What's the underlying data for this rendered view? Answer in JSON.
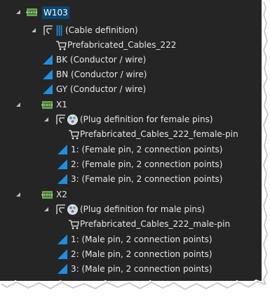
{
  "tree": {
    "rows": [
      {
        "label": "W103",
        "icon": "cable-icon",
        "expander": "open",
        "selected": true
      },
      {
        "label": "(Cable definition)",
        "icon": "cable-definition-icon",
        "expander": "open"
      },
      {
        "label": "Prefabricated_Cables_222",
        "icon": "shopping-cart-icon",
        "expander": "none"
      },
      {
        "label": "BK (Conductor / wire)",
        "icon": "wire-triangle-icon",
        "expander": "none"
      },
      {
        "label": "BN (Conductor / wire)",
        "icon": "wire-triangle-icon",
        "expander": "none"
      },
      {
        "label": "GY (Conductor / wire)",
        "icon": "wire-triangle-icon",
        "expander": "none"
      },
      {
        "label": "X1",
        "icon": "connector-icon",
        "expander": "open"
      },
      {
        "label": "(Plug definition for female pins)",
        "icon": "plug-definition-icon",
        "expander": "open"
      },
      {
        "label": "Prefabricated_Cables_222_female-pin",
        "icon": "shopping-cart-icon",
        "expander": "none"
      },
      {
        "label": "1: (Female pin, 2 connection points)",
        "icon": "pin-triangle-icon",
        "expander": "none"
      },
      {
        "label": "2: (Female pin, 2 connection points)",
        "icon": "pin-triangle-icon",
        "expander": "none"
      },
      {
        "label": "3: (Female pin, 2 connection points)",
        "icon": "pin-triangle-icon",
        "expander": "none"
      },
      {
        "label": "X2",
        "icon": "connector-icon",
        "expander": "open"
      },
      {
        "label": "(Plug definition for male pins)",
        "icon": "plug-definition-icon",
        "expander": "open"
      },
      {
        "label": "Prefabricated_Cables_222_male-pin",
        "icon": "shopping-cart-icon",
        "expander": "none"
      },
      {
        "label": "1: (Male pin, 2 connection points)",
        "icon": "pin-triangle-icon",
        "expander": "none"
      },
      {
        "label": "2: (Male pin, 2 connection points)",
        "icon": "pin-triangle-icon",
        "expander": "none"
      },
      {
        "label": "3: (Male pin, 2 connection points)",
        "icon": "pin-triangle-icon",
        "expander": "none"
      }
    ]
  },
  "colors": {
    "background": "#252526",
    "text": "#e6e6e6",
    "selection": "#094771",
    "accent_blue": "#1e8fe0",
    "connector_green": "#6aa84f"
  }
}
